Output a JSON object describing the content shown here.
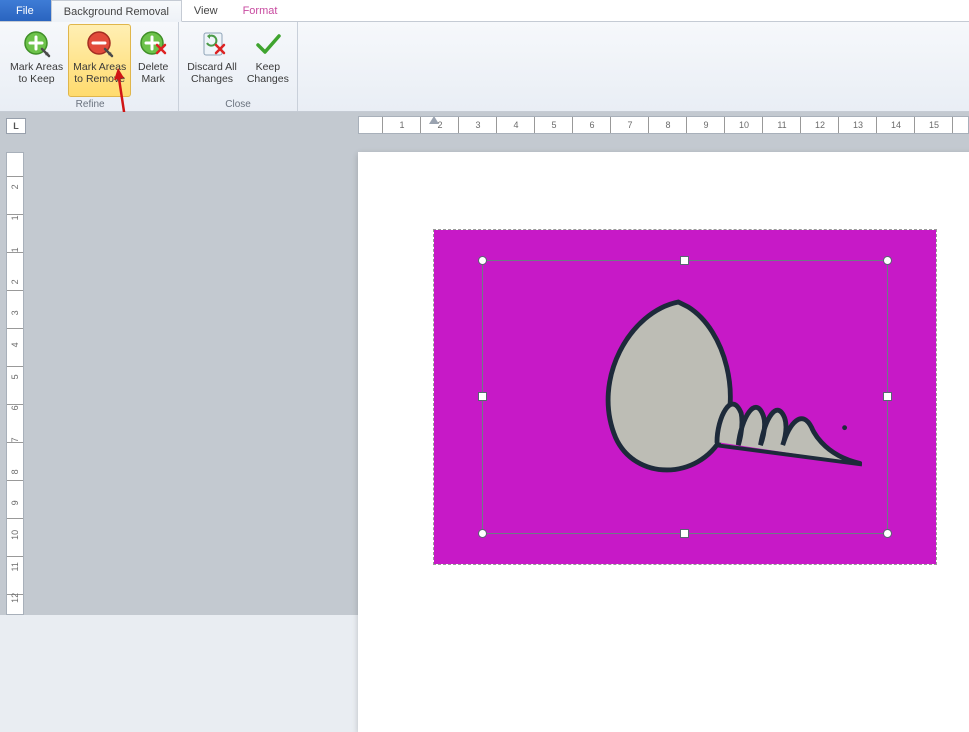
{
  "tabs": {
    "file": "File",
    "bgremoval": "Background Removal",
    "view": "View",
    "format": "Format"
  },
  "ribbon": {
    "refine": {
      "label": "Refine",
      "mark_keep_l1": "Mark Areas",
      "mark_keep_l2": "to Keep",
      "mark_remove_l1": "Mark Areas",
      "mark_remove_l2": "to Remove",
      "delete_l1": "Delete",
      "delete_l2": "Mark"
    },
    "close": {
      "label": "Close",
      "discard_l1": "Discard All",
      "discard_l2": "Changes",
      "keep_l1": "Keep",
      "keep_l2": "Changes"
    }
  },
  "ruler_h": [
    "2",
    "1",
    "",
    "1",
    "2",
    "3",
    "4",
    "5",
    "6",
    "7",
    "8",
    "9",
    "10",
    "11",
    "12",
    "13",
    "14",
    "15"
  ],
  "ruler_v": [
    "",
    "2",
    "1",
    "1",
    "2",
    "3",
    "4",
    "5",
    "6",
    "7",
    "8",
    "9",
    "10",
    "11",
    "12"
  ],
  "icons": {
    "mark_keep": "mark-keep-icon",
    "mark_remove": "mark-remove-icon",
    "delete_mark": "delete-mark-icon",
    "discard": "discard-icon",
    "keep": "keep-icon"
  },
  "colors": {
    "accent_highlight": "#ffdb6e",
    "bg_removal_magenta": "#c719c7",
    "arrow_red": "#d01515"
  }
}
